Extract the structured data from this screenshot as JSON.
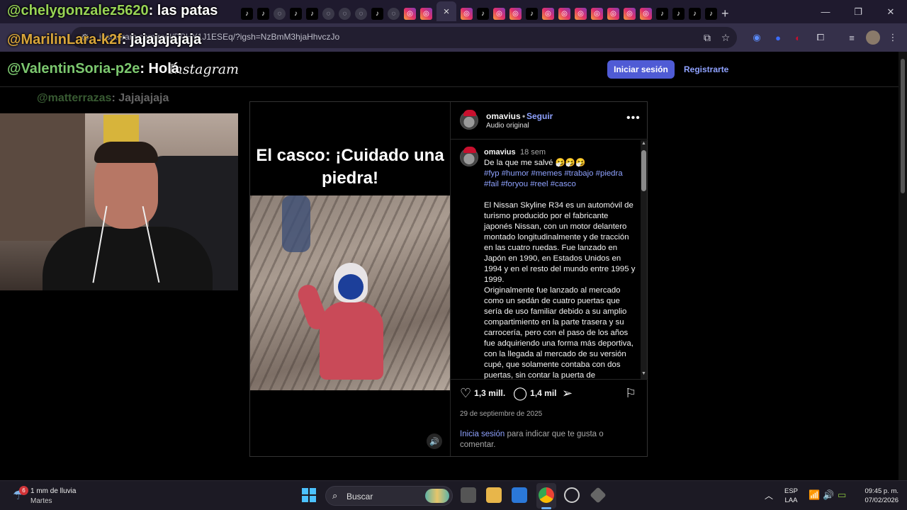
{
  "browser": {
    "tab_strip_icons": [
      "tiktok",
      "tiktok",
      "globe",
      "tiktok",
      "tiktok",
      "globe",
      "globe",
      "globe",
      "tiktok",
      "globe",
      "instagram",
      "instagram",
      "close",
      "instagram",
      "tiktok",
      "instagram",
      "instagram",
      "tiktok",
      "instagram",
      "instagram",
      "instagram",
      "instagram",
      "instagram",
      "instagram",
      "instagram",
      "tiktok",
      "tiktok",
      "tiktok",
      "tiktok"
    ],
    "active_tab_close": "×",
    "new_tab": "+",
    "window_controls": {
      "minimize": "—",
      "restore": "❐",
      "close": "✕"
    },
    "url": "instagram.com/reel/DPHY1J1ESEq/?igsh=NzBmM3hjaHhvczJo"
  },
  "instagram": {
    "logo": "Instagram",
    "login_button": "Iniciar sesión",
    "register_link": "Registrarte",
    "post": {
      "video_caption": "El casco: ¡Cuidado una piedra!",
      "author": "omavius",
      "follow_separator": "•",
      "follow": "Seguir",
      "audio": "Audio original",
      "more": "•••",
      "comment": {
        "author": "omavius",
        "time": "18 sem",
        "first_line": "De la que me salvé 🤧🤧🤧",
        "hashtags": "#fyp #humor #memes #trabajo #piedra #fail #foryou #reel #casco",
        "paragraph_1": "El Nissan Skyline R34 es un automóvil de turismo producido por el fabricante japonés Nissan, con un motor delantero montado longitudinalmente y de tracción en las cuatro ruedas. Fue lanzado en Japón en 1990, en Estados Unidos en 1994 y en el resto del mundo entre 1995 y 1999.",
        "paragraph_2": "Originalmente fue lanzado al mercado como un sedán de cuatro puertas que sería de uso familiar debido a su amplio compartimiento en la parte trasera y su carrocería, pero con el paso de los años fue adquiriendo una forma más deportiva, con la llegada al mercado de su versión cupé, que solamente contaba con dos puertas, sin contar la puerta de"
      },
      "likes": "1,3 mill.",
      "comments_count": "1,4 mil",
      "date": "29 de septiembre de 2025",
      "login_prompt_link": "Inicia sesión",
      "login_prompt_text": " para indicar que te gusta o comentar."
    }
  },
  "chat_overlay": [
    {
      "user": "@chelygonzalez5620",
      "message": ": las patas"
    },
    {
      "user": "@MarilinLara-k2f",
      "message": ": jajajajajaja"
    },
    {
      "user": "@ValentinSoria-p2e",
      "message": ": Holá"
    },
    {
      "user": "@matterrazas",
      "message": ": Jajajajaja"
    }
  ],
  "taskbar": {
    "weather_badge": "6",
    "weather_line1": "1 mm de lluvia",
    "weather_line2": "Martes",
    "search_label": "Buscar",
    "lang_line1": "ESP",
    "lang_line2": "LAA",
    "time": "09:45 p. m.",
    "date": "07/02/2026"
  },
  "colors": {
    "accent": "#4f5bd5",
    "link": "#8fa2ff",
    "tab_bar": "#1f1a2e",
    "toolbar": "#35304a"
  }
}
